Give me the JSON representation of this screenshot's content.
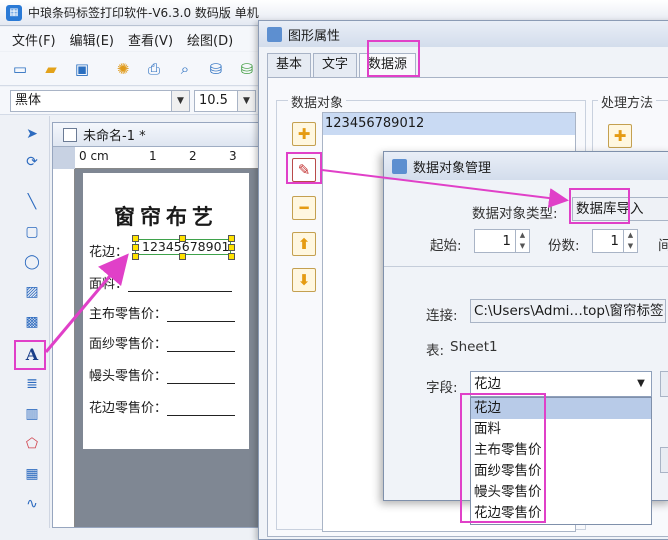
{
  "app": {
    "title": "中琅条码标签打印软件-V6.3.0 数码版 单机"
  },
  "menu": [
    "文件(F)",
    "编辑(E)",
    "查看(V)",
    "绘图(D)"
  ],
  "font_bar": {
    "font_name": "黑体",
    "font_size": "10.5"
  },
  "document": {
    "tab_label": "未命名-1 *",
    "ruler_unit": "0 cm",
    "ruler_marks": [
      "1",
      "2",
      "3"
    ],
    "label": {
      "title": "窗帘布艺",
      "fields": [
        "花边：",
        "面料：",
        "主布零售价：",
        "面纱零售价：",
        "幔头零售价：",
        "花边零售价："
      ],
      "barcode_value": "123456789012"
    }
  },
  "properties_dialog": {
    "title": "图形属性",
    "tabs": [
      "基本",
      "文字",
      "数据源"
    ],
    "active_tab": "数据源",
    "data_objects_label": "数据对象",
    "process_method_label": "处理方法",
    "data_items": [
      "123456789012"
    ]
  },
  "data_object_manager": {
    "title": "数据对象管理",
    "type_label": "数据对象类型:",
    "type_value": "数据库导入",
    "start_label": "起始:",
    "start_value": "1",
    "count_label": "份数:",
    "count_value": "1",
    "interval_label": "间",
    "connection_label": "连接:",
    "connection_value": "C:\\Users\\Admi…top\\窗帘标签.xl",
    "table_label": "表:",
    "table_value": "Sheet1",
    "field_label": "字段:",
    "field_value": "花边",
    "field_options": [
      "花边",
      "面料",
      "主布零售价",
      "面纱零售价",
      "幔头零售价",
      "花边零售价"
    ]
  },
  "colors": {
    "highlight": "#e040c8",
    "selection": "#c9daf3",
    "handle": "#ffe200"
  }
}
